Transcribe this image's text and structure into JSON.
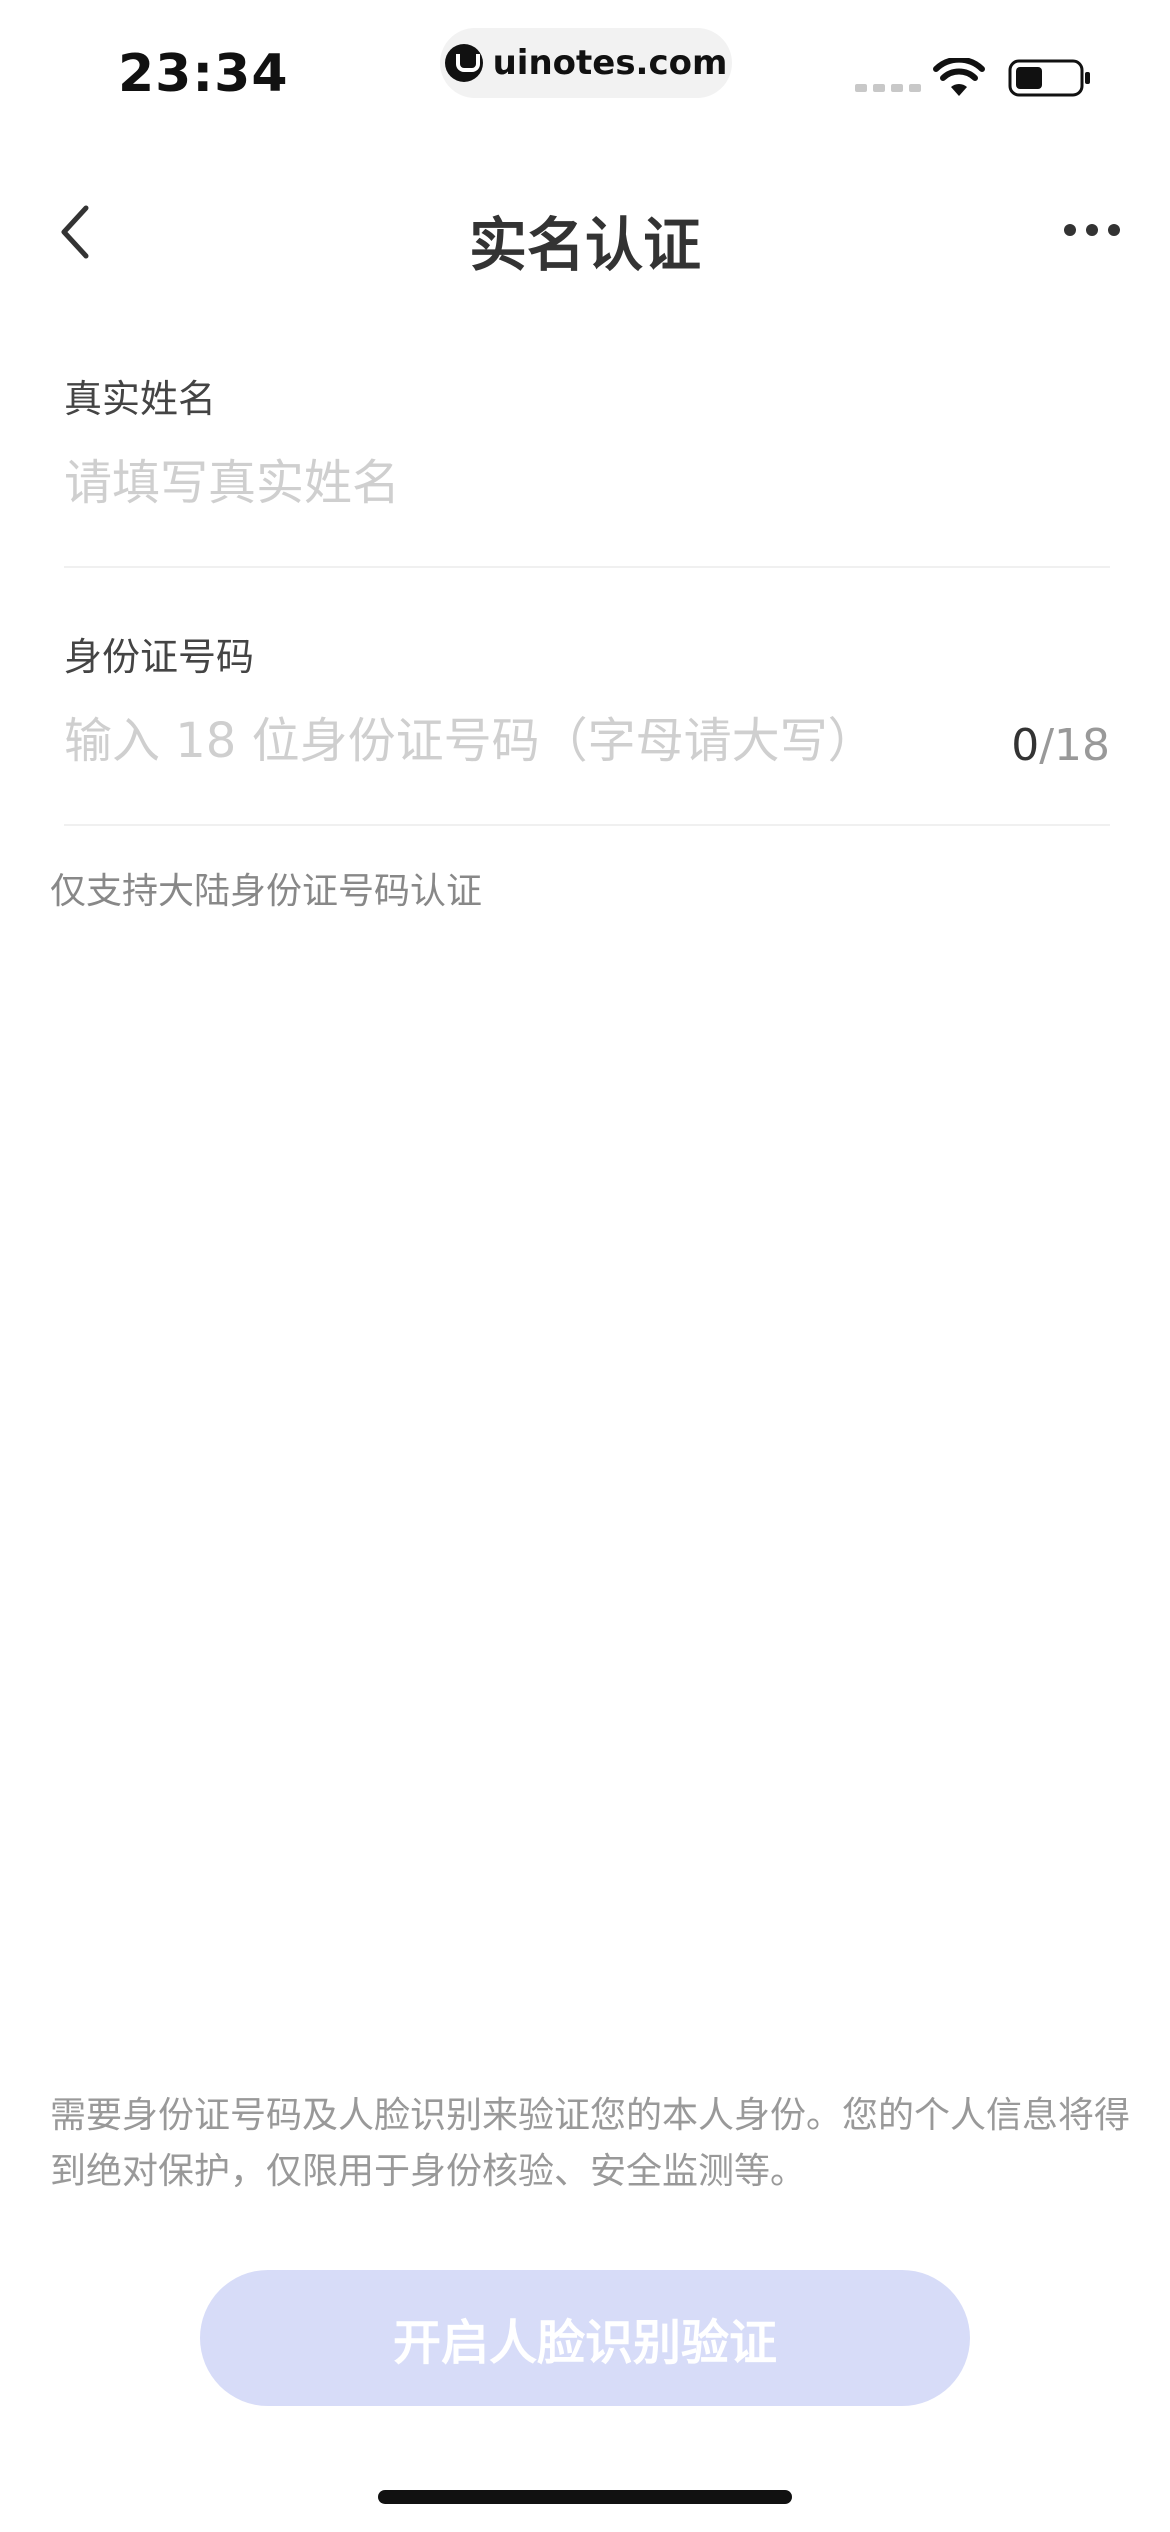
{
  "status_bar": {
    "time": "23:34",
    "url": "uinotes.com"
  },
  "nav": {
    "title": "实名认证",
    "back_icon": "chevron-left-icon",
    "more_icon": "more-horizontal-icon"
  },
  "form": {
    "name": {
      "label": "真实姓名",
      "placeholder": "请填写真实姓名",
      "value": ""
    },
    "id_number": {
      "label": "身份证号码",
      "placeholder": "输入 18 位身份证号码（字母请大写）",
      "value": "",
      "counter_current": "0",
      "counter_max": "/18"
    },
    "hint": "仅支持大陆身份证号码认证"
  },
  "notice": "需要身份证号码及人脸识别来验证您的本人身份。您的个人信息将得到绝对保护，仅限用于身份核验、安全监测等。",
  "submit_button": {
    "label": "开启人脸识别验证",
    "enabled": false
  },
  "colors": {
    "button_disabled_bg": "#d7dcf8",
    "placeholder": "#cfcfcf",
    "title": "#333333"
  }
}
